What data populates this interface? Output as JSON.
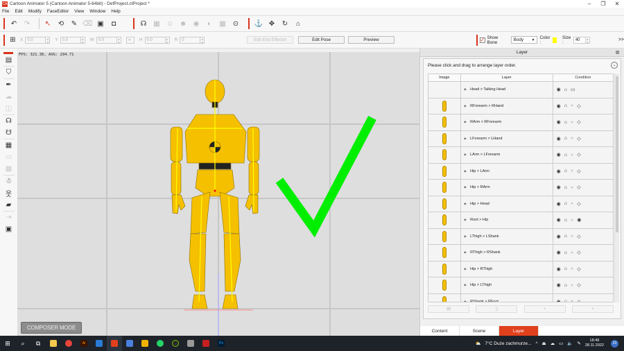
{
  "window": {
    "title": "Cartoon Animator 5  (Cartoon Animator 5-64bit) - DefProject.ctProject *",
    "app_icon": "cartoon-animator-logo",
    "controls": [
      "minimize",
      "restore",
      "close"
    ]
  },
  "menu": [
    "File",
    "Edit",
    "Modify",
    "FaceEditor",
    "View",
    "Window",
    "Help"
  ],
  "toolbar": {
    "groups": [
      [
        "undo-icon",
        "redo-icon"
      ],
      [
        "select-arrow-icon",
        "transform-icon",
        "brush-icon",
        "eraser-icon",
        "dropdown-box-icon",
        "point-box-icon"
      ],
      [
        "head-dropdown-icon",
        "mouth-icon",
        "face-icon",
        "face-settings-icon",
        "eye-icon",
        "eye-brow-icon",
        "face-grid-icon",
        "head-rotate-icon"
      ],
      [
        "anchor-icon",
        "move-icon",
        "rotate-icon",
        "home-dropdown-icon"
      ]
    ]
  },
  "transform_bar": {
    "fields": [
      {
        "label": "X",
        "value": "0.0"
      },
      {
        "label": "Y",
        "value": "0.0"
      },
      {
        "label": "W",
        "value": "0.0"
      },
      {
        "label": "H",
        "value": "0.0"
      },
      {
        "label": "R",
        "value": "0"
      }
    ],
    "edit_end_effector": "Edit End Effector",
    "edit_pose": "Edit Pose",
    "preview": "Preview",
    "show_bone_label": "Show Bone",
    "show_bone_checked": true,
    "bone_select": "Body",
    "color_label": "Color :",
    "bone_color": "#ffff00",
    "size_label": "Size :",
    "size_value": "40",
    "more": ">>"
  },
  "left_tools": [
    "bone-editor-icon",
    "sprite-editor-icon",
    "pen-icon",
    "cloud-icon",
    "mask-icon",
    "head-dummy-icon",
    "head-link-icon",
    "grid-keys-icon",
    "frame-icon",
    "pixel-icon",
    "bone-puppet-icon",
    "character-icon",
    "ruler-icon",
    "export-icon",
    "layer-order-icon"
  ],
  "viewport": {
    "fps_text": "FPS: 321.36, AVG: 294.71",
    "composer_mode": "COMPOSER MODE",
    "checkmark_color": "#00ee00"
  },
  "layer_panel": {
    "title": "Layer",
    "hint": "Please click and drag to arrange layer order.",
    "columns": [
      "Image",
      "Layer",
      "Condition"
    ],
    "rows": [
      {
        "layer": "Head > Talking Head",
        "condition": [
          "eye",
          "lock",
          "frame"
        ],
        "thumb": false
      },
      {
        "layer": "RForearm > RHand",
        "condition": [
          "eye",
          "lock",
          "dot",
          "diamond"
        ],
        "thumb": true
      },
      {
        "layer": "RArm > RForearm",
        "condition": [
          "eye",
          "lock",
          "dot",
          "diamond"
        ],
        "thumb": true
      },
      {
        "layer": "LForearm > LHand",
        "condition": [
          "eye",
          "lock",
          "dot",
          "diamond"
        ],
        "thumb": true
      },
      {
        "layer": "LArm > LForearm",
        "condition": [
          "eye",
          "lock",
          "dot",
          "diamond"
        ],
        "thumb": true
      },
      {
        "layer": "Hip > LArm",
        "condition": [
          "eye",
          "lock",
          "dot",
          "diamond"
        ],
        "thumb": true
      },
      {
        "layer": "Hip > RArm",
        "condition": [
          "eye",
          "lock",
          "dot",
          "diamond"
        ],
        "thumb": true
      },
      {
        "layer": "Hip > Head",
        "condition": [
          "eye",
          "lock",
          "dot",
          "diamond"
        ],
        "thumb": true
      },
      {
        "layer": "Root > Hip",
        "condition": [
          "eye",
          "lock",
          "dot",
          "eye"
        ],
        "thumb": true
      },
      {
        "layer": "LThigh > LShank",
        "condition": [
          "eye",
          "lock",
          "dot",
          "diamond"
        ],
        "thumb": true
      },
      {
        "layer": "RThigh > RShank",
        "condition": [
          "eye",
          "lock",
          "dot",
          "diamond"
        ],
        "thumb": true
      },
      {
        "layer": "Hip > RThigh",
        "condition": [
          "eye",
          "lock",
          "dot",
          "diamond"
        ],
        "thumb": true
      },
      {
        "layer": "Hip > LThigh",
        "condition": [
          "eye",
          "lock",
          "dot",
          "diamond"
        ],
        "thumb": true
      },
      {
        "layer": "RShank > RFoot",
        "condition": [
          "eye",
          "lock",
          "dot",
          "diamond"
        ],
        "thumb": true
      }
    ],
    "actions": [
      "save-icon",
      "copy-icon",
      "add-icon",
      "delete-icon"
    ],
    "tabs": [
      "Content",
      "Scene",
      "Layer"
    ],
    "active_tab": "Layer"
  },
  "taskbar": {
    "apps": [
      "start",
      "search",
      "task-view",
      "file-explorer",
      "chrome",
      "illustrator",
      "app-blue",
      "cartoon-animator",
      "save-app",
      "yellow-app",
      "whatsapp",
      "green-app",
      "ipad-app",
      "red-app",
      "photoshop"
    ],
    "weather": "7°C  Duże zachmurze...",
    "time": "18:49",
    "date": "28.11.2022",
    "notifications": "23"
  }
}
